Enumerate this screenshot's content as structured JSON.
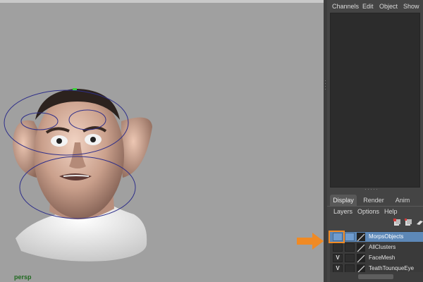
{
  "viewport": {
    "camera_label": "persp"
  },
  "panel": {
    "menu": [
      "Channels",
      "Edit",
      "Object",
      "Show"
    ],
    "tabs": [
      "Display",
      "Render",
      "Anim"
    ],
    "active_tab": "Display",
    "submenu": [
      "Layers",
      "Options",
      "Help"
    ],
    "layers": [
      {
        "name": "MorpsObjects",
        "visible": "",
        "selected": true
      },
      {
        "name": "AllClusters",
        "visible": "",
        "selected": false
      },
      {
        "name": "FaceMesh",
        "visible": "V",
        "selected": false
      },
      {
        "name": "TeathTounqueEye",
        "visible": "V",
        "selected": false
      }
    ]
  },
  "colors": {
    "highlight": "#f08a24",
    "selection": "#5d88b8",
    "viewport_bg": "#a0a0a0"
  }
}
